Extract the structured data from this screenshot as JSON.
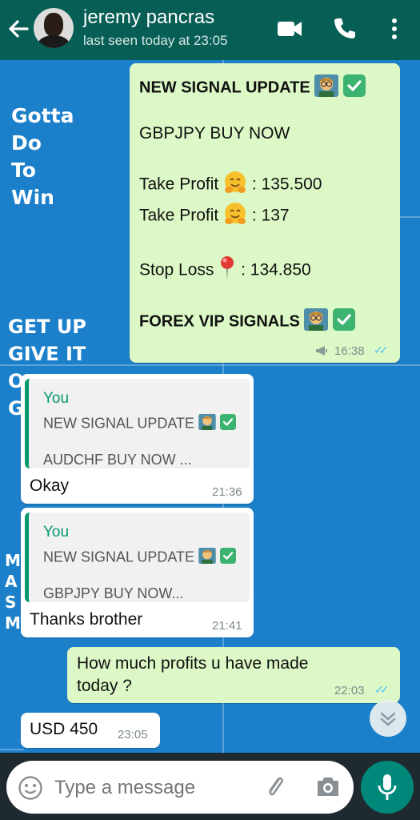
{
  "header": {
    "contact_name": "jeremy pancras",
    "last_seen": "last seen today at 23:05",
    "icons": [
      "back-arrow-icon",
      "video-call-icon",
      "phone-icon",
      "more-options-icon"
    ]
  },
  "wallpaper": {
    "texts": [
      "Gotta",
      "Do",
      "To",
      "Win",
      "GET UP",
      "GIVE IT",
      "O",
      "G",
      "M",
      "A",
      "S",
      "M"
    ]
  },
  "messages": [
    {
      "direction": "outgoing",
      "lines": [
        "NEW SIGNAL UPDATE",
        "GBPJPY BUY NOW",
        "Take Profit",
        ": 135.500",
        "Take Profit",
        ": 137",
        "Stop Loss",
        ": 134.850",
        "FOREX VIP SIGNALS"
      ],
      "time": "16:38",
      "status": "read"
    },
    {
      "direction": "incoming",
      "quote": {
        "author": "You",
        "line1": "NEW SIGNAL UPDATE",
        "line2": "AUDCHF BUY NOW ..."
      },
      "text": "Okay",
      "time": "21:36"
    },
    {
      "direction": "incoming",
      "quote": {
        "author": "You",
        "line1": "NEW SIGNAL UPDATE",
        "line2": "GBPJPY BUY NOW..."
      },
      "text": "Thanks brother",
      "time": "21:41"
    },
    {
      "direction": "outgoing",
      "lines": [
        "How much profits u have made",
        "today ?"
      ],
      "time": "22:03",
      "status": "read"
    },
    {
      "direction": "incoming",
      "text": "USD 450",
      "time": "23:05"
    }
  ],
  "composer": {
    "placeholder": "Type a message",
    "icons": [
      "emoji-icon",
      "attach-icon",
      "camera-icon",
      "mic-icon"
    ]
  },
  "colors": {
    "header": "#075e54",
    "outgoing_bubble": "#dcf8c6",
    "incoming_bubble": "#ffffff",
    "accent": "#06976f",
    "read_ticks": "#4fc3f7",
    "wallpaper": "#1b7fc9"
  }
}
